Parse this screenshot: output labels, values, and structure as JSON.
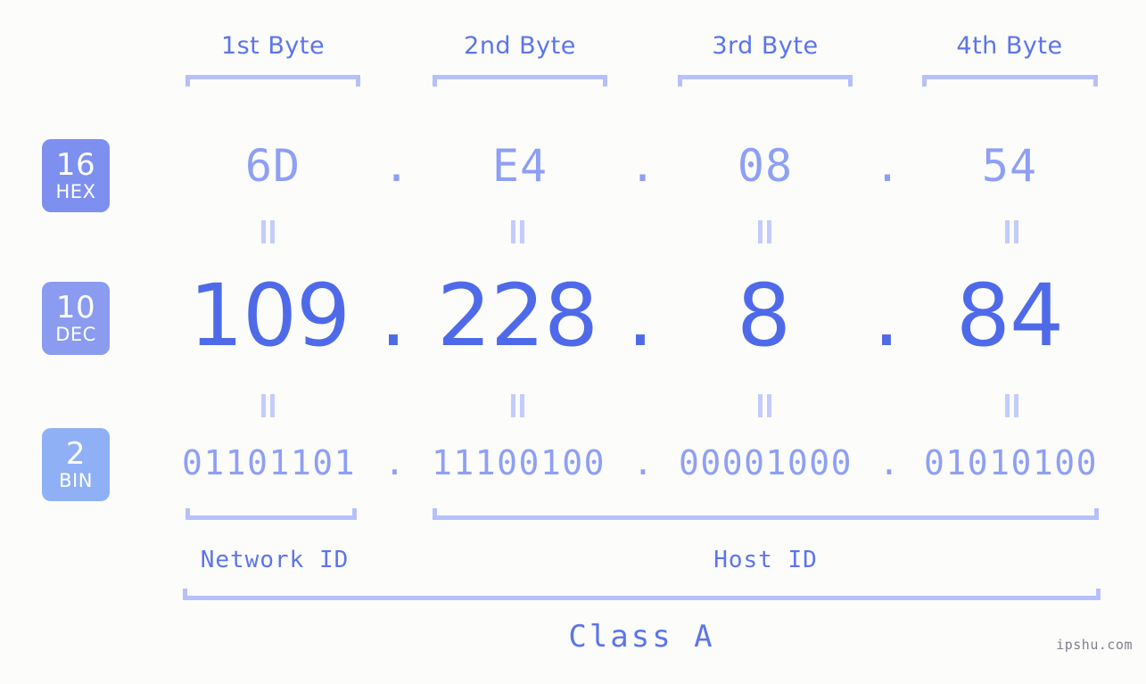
{
  "background_color": "#fcfdfa",
  "accent_color": "#5c74ec",
  "light_accent_color": "#8e9ff5",
  "bracket_color": "#b6c0fb",
  "header": {
    "bytes": [
      {
        "label": "1st Byte"
      },
      {
        "label": "2nd Byte"
      },
      {
        "label": "3rd Byte"
      },
      {
        "label": "4th Byte"
      }
    ]
  },
  "bases": [
    {
      "number": "16",
      "name": "HEX",
      "color": "#7d90f0"
    },
    {
      "number": "10",
      "name": "DEC",
      "color": "#8a9bf0"
    },
    {
      "number": "2",
      "name": "BIN",
      "color": "#8fb0f4"
    }
  ],
  "rows": {
    "hex": {
      "base_number": "16",
      "base_name": "HEX",
      "values": [
        "6D",
        "E4",
        "08",
        "54"
      ],
      "separator": "."
    },
    "dec": {
      "base_number": "10",
      "base_name": "DEC",
      "values": [
        "109",
        "228",
        "8",
        "84"
      ],
      "separator": "."
    },
    "bin": {
      "base_number": "2",
      "base_name": "BIN",
      "values": [
        "01101101",
        "11100100",
        "00001000",
        "01010100"
      ],
      "separator": "."
    }
  },
  "equals_symbol": "=",
  "segments": {
    "network_id": "Network ID",
    "host_id": "Host ID"
  },
  "class_label": "Class A",
  "watermark": "ipshu.com",
  "ip_address": {
    "dec": "109.228.8.84",
    "hex": "6D.E4.08.54",
    "bin": "01101101.11100100.00001000.01010100"
  }
}
